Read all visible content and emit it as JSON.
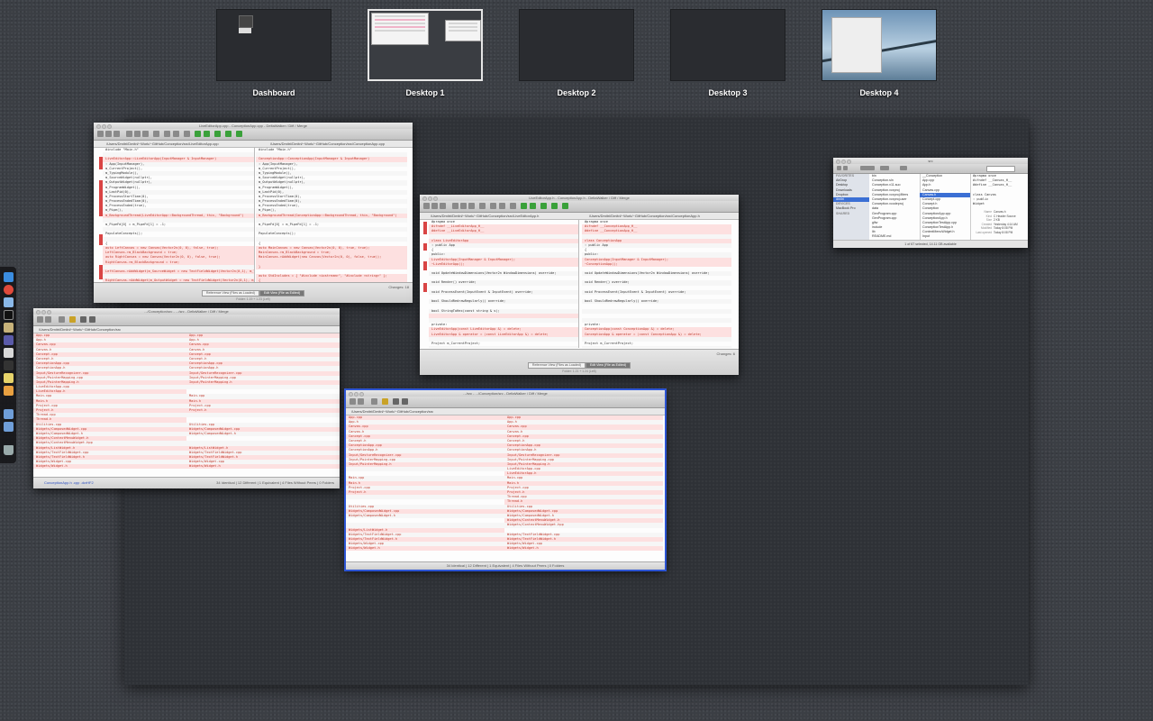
{
  "spaces": [
    {
      "label": "Dashboard"
    },
    {
      "label": "Desktop 1"
    },
    {
      "label": "Desktop 2"
    },
    {
      "label": "Desktop 3"
    },
    {
      "label": "Desktop 4"
    }
  ],
  "windows": {
    "diff_top_left": {
      "title": "LiveEditorApp.cpp - ConceptionApp.cpp - DeltaWalker / Diff / Merge",
      "left_path": "/Users/Dmitri/Dmitri/~Work/~GitHub/Conception/src/LiveEditorApp.cpp",
      "right_path": "/Users/Dmitri/Dmitri/~Work/~GitHub/Conception/src/ConceptionApp.cpp",
      "left_lines": [
        "#include \"Main.h\"",
        "",
        "LiveEditorApp::LiveEditorApp(InputManager & InputManager)",
        "    : App(InputManager),",
        "      m_CurrentProject(),",
        "      m_TypingModule(),",
        "      m_SourceWidget(nullptr),",
        "      m_OutputWidget(nullptr),",
        "      m_ProgramWidget(),",
        "      m_LastPid(0),",
        "      m_ProcessStartTime(0),",
        "      m_ProcessEndedTime(0),",
        "      m_ProcessEnded(true),",
        "      m_Pipe(),",
        "      m_BackgroundThread(LiveEditorApp::BackgroundThread, this, \"Background\")",
        "",
        "    m_PipeFd[0] = m_PipeFd[1] = -1;",
        "",
        "    PopulateConcepts();",
        "",
        "    {",
        "        auto LeftCanvas = new Canvas(Vector2n(0, 0), false, true);",
        "        LeftCanvas->m_BlackBackground = true;",
        "        auto RightCanvas = new Canvas(Vector2n(0, 0), false, true);",
        "        RightCanvas->m_BlackBackground = true;",
        "",
        "        LeftCanvas->AddWidget(m_SourceWidget = new TextFieldWidget(Vector2n(0,1), m_TypingModule));",
        "",
        "        RightCanvas->AddWidget(m_OutputWidget = new TextFieldWidget(Vector2n(0,1), m_TypingModule));",
        "",
        "        {",
        "            m_SourceWidget->m_OnChange = [&, LeftCanvas, RightCanvas]() {",
        "",
        "        }"
      ],
      "right_lines": [
        "#include \"Main.h\"",
        "",
        "ConceptionApp::ConceptionApp(InputManager & InputManager)",
        "    : App(InputManager),",
        "      m_CurrentProject(),",
        "      m_TypingModule(),",
        "      m_SourceWidget(nullptr),",
        "      m_OutputWidget(nullptr),",
        "      m_ProgramWidget(),",
        "      m_LastPid(0),",
        "      m_ProcessStartTime(0),",
        "      m_ProcessEndedTime(0),",
        "      m_ProcessEnded(true),",
        "      m_Pipe(),",
        "      m_BackgroundThread(ConceptionApp::BackgroundThread, this, \"Background\")",
        "",
        "    m_PipeFd[0] = m_PipeFd[1] = -1;",
        "",
        "    PopulateConcepts();",
        "",
        "    {",
        "        auto MainCanvas = new Canvas(Vector2n(0, 0), true, true);",
        "        MainCanvas->m_BlackBackground = true;",
        "        MainCanvas->AddWidget(new Canvas(Vector2n(0, 0), false, true));",
        "",
        "    }",
        "",
        "        auto StdIncludes = { \"#include <iostream>\", \"#include <string>\" };",
        "        {",
        "            auto Entry = m_TypingModule.Entry();",
        "",
        "            if (Entry.length() > 0)",
        "                auto Concepts = FindOrCreateConcept(Entry);",
        "        }"
      ],
      "reference_label": "Reference View (Files as Loaded)",
      "edit_label": "Edit View (File as Edited)",
      "changes": "Changes: 18",
      "status": "Folder: 1.19 + 1.23 (Left)"
    },
    "diff_center": {
      "title": "LiveEditorApp.h - ConceptionApp.h - DeltaWalker / Diff / Merge",
      "left_path": "/Users/Dmitri/Dmitri/~Work/~GitHub/Conception/src/LiveEditorApp.h",
      "right_path": "/Users/Dmitri/Dmitri/~Work/~GitHub/Conception/src/ConceptionApp.h",
      "left_lines": [
        "#pragma once",
        "#ifndef __LiveEditorApp_H__",
        "#define __LiveEditorApp_H__",
        "",
        "class LiveEditorApp",
        "    : public App",
        "{",
        "public:",
        "    LiveEditorApp(InputManager & InputManager);",
        "    ~LiveEditorApp();",
        "",
        "    void UpdateWindowDimensions(Vector2n WindowDimensions) override;",
        "",
        "    void Render() override;",
        "",
        "    void ProcessEvent(InputEvent & InputEvent) override;",
        "",
        "    bool ShouldRedrawRegularly() override;",
        "",
        "    bool StringToHex(const string & s);",
        "",
        "",
        "private:",
        "    LiveEditorApp(const LiveEditorApp &) = delete;",
        "    LiveEditorApp & operator = (const LiveEditorApp &) = delete;",
        "",
        "    Project        m_CurrentProject;",
        "",
        "    TypingModule   m_TypingModule;",
        "",
        "    TextFieldWidget * m_SourceWidget;",
        "    TextFieldWidget * m_OutputWidget;",
        "",
        "    volatile uint32  m_BackgroundState;",
        "    volatile pid_t   m_LastPid;",
        "    volatile double  m_ProcessStartTime;",
        "    volatile double  m_ProcessEndedTime;",
        "    volatile bool    m_ProcessEnded;",
        "    volatile bool    m_Pipe;"
      ],
      "right_lines": [
        "#pragma once",
        "#ifndef __ConceptionApp_H__",
        "#define __ConceptionApp_H__",
        "",
        "class ConceptionApp",
        "    : public App",
        "{",
        "public:",
        "    ConceptionApp(InputManager & InputManager);",
        "    ~ConceptionApp();",
        "",
        "    void UpdateWindowDimensions(Vector2n WindowDimensions) override;",
        "",
        "    void Render() override;",
        "",
        "    void ProcessEvent(InputEvent & InputEvent) override;",
        "",
        "    bool ShouldRedrawRegularly() override;",
        "",
        "",
        "",
        "",
        "private:",
        "    ConceptionApp(const ConceptionApp &) = delete;",
        "    ConceptionApp & operator = (const ConceptionApp &) = delete;",
        "",
        "    Project        m_CurrentProject;",
        "",
        "    TypingModule   m_TypingModule;",
        "",
        "    TextFieldWidget * m_SourceWidget;",
        "    TextFieldWidget * m_OutputWidget;",
        "",
        "    volatile uint32  m_BackgroundState;",
        "    volatile pid_t   m_LastPid;",
        "    volatile double  m_ProcessStartTime;",
        "    volatile double  m_ProcessEndedTime;",
        "    volatile bool    m_ProcessEnded;",
        "    volatile bool    m_Pipe;"
      ],
      "reference_label": "Reference View (Files as Loaded)",
      "edit_label": "Edit View (File as Edited)",
      "changes": "Changes: 6",
      "status": "Folder: 1.21 + 1.24 (Left)"
    },
    "folder_left": {
      "title": ".../Conception/src - .../src - DeltaWalker / Diff / Merge",
      "path": "/Users/Dmitri/Dmitri/~Work/~GitHub/Conception/src",
      "left_files": [
        "App.cpp",
        "App.h",
        "Canvas.cpp",
        "Canvas.h",
        "Concept.cpp",
        "Concept.h",
        "ConceptionApp.cpp",
        "ConceptionApp.h",
        "Input/GestureRecognizer.cpp",
        "Input/PointerMapping.cpp",
        "Input/PointerMapping.h",
        "LiveEditorApp.cpp",
        "LiveEditorApp.h",
        "Main.cpp",
        "Main.h",
        "Project.cpp",
        "Project.h",
        "Thread.cpp",
        "Thread.h",
        "Utilities.cpp",
        "Widgets/ComposedWidget.cpp",
        "Widgets/ComposedWidget.h",
        "Widgets/ContextMenuWidget.h",
        "Widgets/ContextMenuWidget.hpp",
        "Widgets/ListWidget.h",
        "Widgets/TextFieldWidget.cpp",
        "Widgets/TextFieldWidget.h",
        "Widgets/Widget.cpp",
        "Widgets/Widget.h"
      ],
      "right_files": [
        "App.cpp",
        "App.h",
        "Canvas.cpp",
        "Canvas.h",
        "Concept.cpp",
        "Concept.h",
        "ConceptionApp.cpp",
        "ConceptionApp.h",
        "Input/GestureRecognizer.cpp",
        "Input/PointerMapping.cpp",
        "Input/PointerMapping.h",
        "",
        "",
        "Main.cpp",
        "Main.h",
        "Project.cpp",
        "Project.h",
        "",
        "",
        "Utilities.cpp",
        "Widgets/ComposedWidget.cpp",
        "Widgets/ComposedWidget.h",
        "",
        "",
        "Widgets/ListWidget.h",
        "Widgets/TextFieldWidget.cpp",
        "Widgets/TextFieldWidget.h",
        "Widgets/Widget.cpp",
        "Widgets/Widget.h"
      ],
      "status": "34 Identical | 12 Different | 1 Equivalent | 4 Files Without Peers | 0 Folders",
      "footer": "ConceptionApp.h   .cpp   .dcrHF2"
    },
    "folder_active": {
      "title": ".../src - .../Conception/src - DeltaWalker / Diff / Merge",
      "path": "/Users/Dmitri/Dmitri/~Work/~GitHub/Conception/src",
      "left_files": [
        "App.cpp",
        "App.h",
        "Canvas.cpp",
        "Canvas.h",
        "Concept.cpp",
        "Concept.h",
        "ConceptionApp.cpp",
        "ConceptionApp.h",
        "Input/GestureRecognizer.cpp",
        "Input/PointerMapping.cpp",
        "Input/PointerMapping.h",
        "",
        "",
        "Main.cpp",
        "Main.h",
        "Project.cpp",
        "Project.h",
        "",
        "",
        "Utilities.cpp",
        "Widgets/ComposedWidget.cpp",
        "Widgets/ComposedWidget.h",
        "",
        "",
        "Widgets/ListWidget.h",
        "Widgets/TextFieldWidget.cpp",
        "Widgets/TextFieldWidget.h",
        "Widgets/Widget.cpp",
        "Widgets/Widget.h"
      ],
      "right_files": [
        "App.cpp",
        "App.h",
        "Canvas.cpp",
        "Canvas.h",
        "Concept.cpp",
        "Concept.h",
        "ConceptionApp.cpp",
        "ConceptionApp.h",
        "Input/GestureRecognizer.cpp",
        "Input/PointerMapping.cpp",
        "Input/PointerMapping.h",
        "LiveEditorApp.cpp",
        "LiveEditorApp.h",
        "Main.cpp",
        "Main.h",
        "Project.cpp",
        "Project.h",
        "Thread.cpp",
        "Thread.h",
        "Utilities.cpp",
        "Widgets/ComposedWidget.cpp",
        "Widgets/ComposedWidget.h",
        "Widgets/ContextMenuWidget.h",
        "Widgets/ContextMenuWidget.hpp",
        "",
        "Widgets/TextFieldWidget.cpp",
        "Widgets/TextFieldWidget.h",
        "Widgets/Widget.cpp",
        "Widgets/Widget.h"
      ],
      "status": "34 Identical | 12 Different | 1 Equivalent | 4 Files Without Peers | 0 Folders"
    },
    "finder": {
      "title": "src",
      "sidebar_header": "FAVORITES",
      "sidebar_items": [
        "AirDrop",
        "Desktop",
        "Downloads",
        "Dropbox",
        "dmitri"
      ],
      "devices_header": "DEVICES",
      "devices": [
        "MacBook Pro"
      ],
      "shared_header": "SHARED",
      "col1": [
        "bin",
        "Conception.sln",
        "Conception.v11.suo",
        "Conception.vcxproj",
        "Conception.vcxproj.filters",
        "Conception.vcxproj.user",
        "Conception.xcodeproj",
        "data",
        "GenProgram.cpp",
        "GenProgram.cpp",
        "glfw",
        "include",
        "lib",
        "README.md",
        "src"
      ],
      "col2": [
        "__Conception",
        "App.cpp",
        "App.h",
        "Canvas.cpp",
        "Canvas.h",
        "Concept.cpp",
        "Concept.h",
        "Conception",
        "ConceptionApp.cpp",
        "ConceptionApp.h",
        "ConceptionTestApp.cpp",
        "ConceptionTestApp.h",
        "ContextMenuWidget.h",
        "Input",
        "LiveEditorApp.cpp"
      ],
      "preview_lines": [
        "#pragma once",
        "#ifndef __Canvas_H__",
        "#define __Canvas_H__",
        "",
        "class Canvas",
        "    : public",
        "Widget"
      ],
      "info_labels": [
        "Name",
        "Kind",
        "Size",
        "Created",
        "Modified",
        "Last opened"
      ],
      "info_values": [
        "Canvas.h",
        "C Header Source",
        "2 KB",
        "Yesterday 4:14 AM",
        "Today 8:08 PM",
        "Today 8:08 PM"
      ],
      "status": "1 of 67 selected, 14.11 GB available"
    }
  },
  "dock": {
    "items": [
      "finder-icon",
      "chrome-icon",
      "safari-icon",
      "terminal-icon",
      "app-icon",
      "app-icon",
      "app-icon",
      "app-icon",
      "app-icon",
      "folder-icon",
      "folder-icon",
      "trash-icon"
    ]
  },
  "colors": {
    "accent_blue": "#2d55d4",
    "diff_red": "#c0392b",
    "diff_blue": "#2b4ec0"
  }
}
